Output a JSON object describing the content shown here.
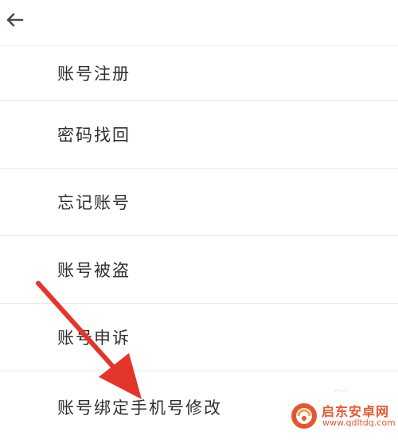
{
  "header": {
    "back_icon": "arrow-left-icon"
  },
  "menu": {
    "items": [
      {
        "label": "账号注册"
      },
      {
        "label": "密码找回"
      },
      {
        "label": "忘记账号"
      },
      {
        "label": "账号被盗"
      },
      {
        "label": "账号申诉"
      },
      {
        "label": "账号绑定手机号修改"
      }
    ]
  },
  "annotation": {
    "arrow_icon": "red-pointer-arrow-icon",
    "color": "#e4352a"
  },
  "watermark": {
    "name": "启东安卓网",
    "url": "www.qdltdq.com",
    "color": "#e4572e"
  }
}
